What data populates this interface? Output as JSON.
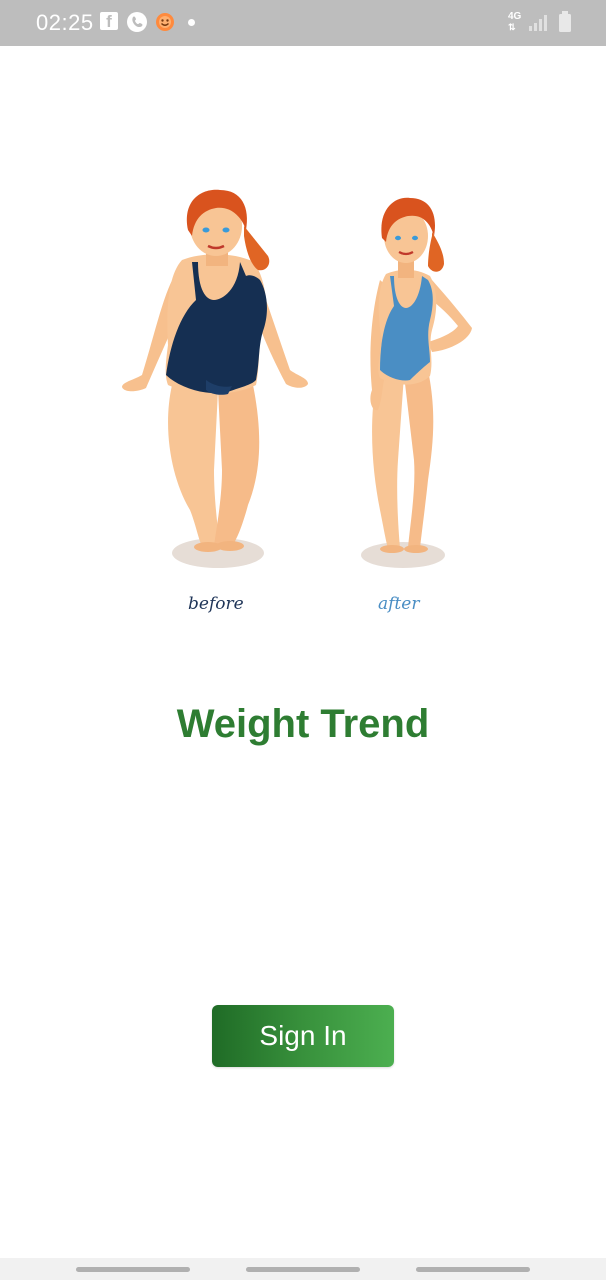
{
  "status_bar": {
    "time": "02:25",
    "network": "4G",
    "icons": [
      "facebook-icon",
      "phone-icon",
      "smile-icon",
      "notification-dot-icon",
      "signal-icon",
      "battery-icon"
    ]
  },
  "illustration": {
    "before_label": "before",
    "after_label": "after"
  },
  "app": {
    "title": "Weight Trend"
  },
  "actions": {
    "sign_in_label": "Sign In"
  },
  "colors": {
    "title_green": "#2e7d32",
    "button_dark": "#1f6b26",
    "button_light": "#4caf50",
    "status_bar": "#bdbdbd"
  }
}
